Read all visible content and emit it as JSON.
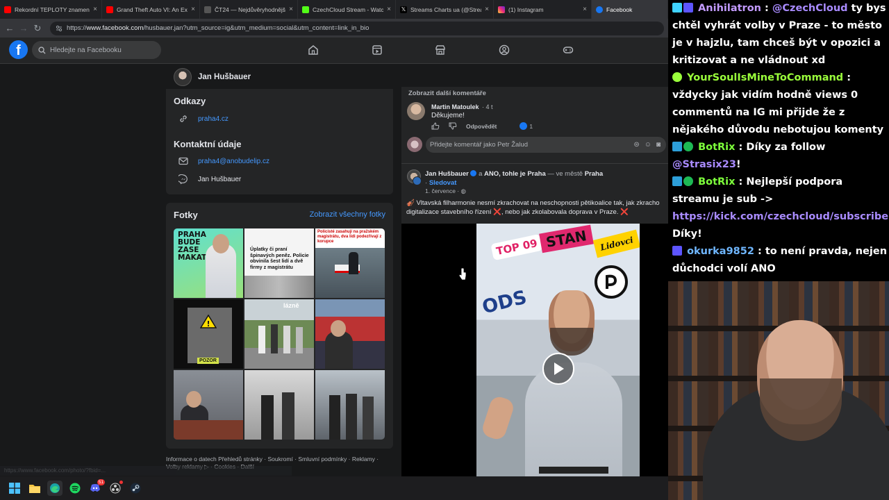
{
  "browser": {
    "tabs": [
      {
        "title": "Rekordní TEPLOTY znamenají",
        "favicon_color": "#ff0000"
      },
      {
        "title": "Grand Theft Auto VI: An Exte",
        "favicon_color": "#ff0000"
      },
      {
        "title": "ČT24 — Nejdůvěryhodnější z",
        "favicon_color": "#444444"
      },
      {
        "title": "CzechCloud Stream - Watch L",
        "favicon_color": "#53fc18"
      },
      {
        "title": "Streams Charts ua (@Stream",
        "favicon_color": "#111111"
      },
      {
        "title": "(1) Instagram",
        "favicon_color": "#e1306c"
      },
      {
        "title": "Facebook",
        "favicon_color": "#1877f2",
        "active": true
      }
    ],
    "url_prefix": "https://",
    "url_host": "www.facebook.com",
    "url_path": "/husbauer.jan?utm_source=ig&utm_medium=social&utm_content=link_in_bio"
  },
  "facebook": {
    "logo": "f",
    "search_placeholder": "Hledejte na Facebooku",
    "nav_icons": [
      "home-icon",
      "video-icon",
      "marketplace-icon",
      "profile-icon",
      "gaming-icon"
    ],
    "profile": {
      "name": "Jan Hušbauer"
    },
    "links_card": {
      "title": "Odkazy",
      "link": "praha4.cz"
    },
    "contact_card": {
      "title": "Kontaktní údaje",
      "email": "praha4@anobudelip.cz",
      "messenger": "Jan Hušbauer"
    },
    "photos_card": {
      "title": "Fotky",
      "show_all": "Zobrazit všechny fotky",
      "photo1_text": [
        "PRAHA",
        "BUDE",
        "ZASE",
        "MAKAT"
      ],
      "photo2_headline": "Úplatky či praní špinavých peněz. Policie obvinila šest lidí a dvě firmy z magistrátu",
      "photo3_headline": "Policisté zasahují na pražském magistrátu, dva lidi podezřívají z korupce",
      "photo4_label": "POZOR",
      "photo5_sign": "lázně"
    },
    "footer": {
      "line1": "Informace o datech Přehledů stránky · Soukromí · Smluvní podmínky · Reklamy ·",
      "line2": "Volby reklamy ▷ · Cookies · Další"
    }
  },
  "feed": {
    "more_comments": "Zobrazit další komentáře",
    "comment": {
      "author": "Martin Matoulek",
      "time": "4 t",
      "text": "Děkujeme!",
      "reply": "Odpovědět",
      "likes": "1"
    },
    "comment_placeholder": "Přidejte komentář jako Petr Žalud",
    "post": {
      "author": "Jan Hušbauer",
      "with": "a",
      "page": "ANO, tohle je Praha",
      "location_prefix": "— ve městě",
      "location": "Praha",
      "follow_prefix": "·",
      "follow": "Sledovat",
      "date": "1. července ·",
      "text": "🎻 Vltavská filharmonie nesmí zkrachovat na neschopnosti pětikoalice tak, jak zkracho digitalizace stavebního řízení ❌, nebo jak zkolabovala doprava v Praze. ❌",
      "video_labels": {
        "top": "TOP 09",
        "stan": "STAN",
        "lidovci": "Lidovci",
        "ods": "ODS"
      }
    }
  },
  "chat": {
    "messages": [
      {
        "user": "Anihilatron",
        "user_color": "#c39bff",
        "mention": "@CzechCloud",
        "text": "ty bys chtěl vyhrát volby v Praze - to město je v hajzlu, tam chceš být v opozici a kritizovat a ne vládnout xd"
      },
      {
        "user": "YourSoulIsMineToCommand",
        "user_color": "#9aff3b",
        "text": "vždycky jak vidím hodně views 0 commentů na IG mi přijde že z nějakého důvodu nebotujou komenty"
      },
      {
        "user": "BotRix",
        "user_color": "#7dff3b",
        "text_before": "Díky za follow",
        "mention": "@Strasix23",
        "text_after": "!"
      },
      {
        "user": "BotRix",
        "user_color": "#7dff3b",
        "text": "Nejlepší podpora streamu je sub ->",
        "link": "https://kick.com/czechcloud/subscribe",
        "text_after": "Díky!"
      },
      {
        "user": "okurka9852",
        "user_color": "#6fb6ff",
        "text": "to není pravda, nejen důchodci volí ANO"
      }
    ]
  },
  "taskbar": {
    "discord_badge": "51"
  },
  "status_url": "https://www.facebook.com/photo/?fbid=..."
}
